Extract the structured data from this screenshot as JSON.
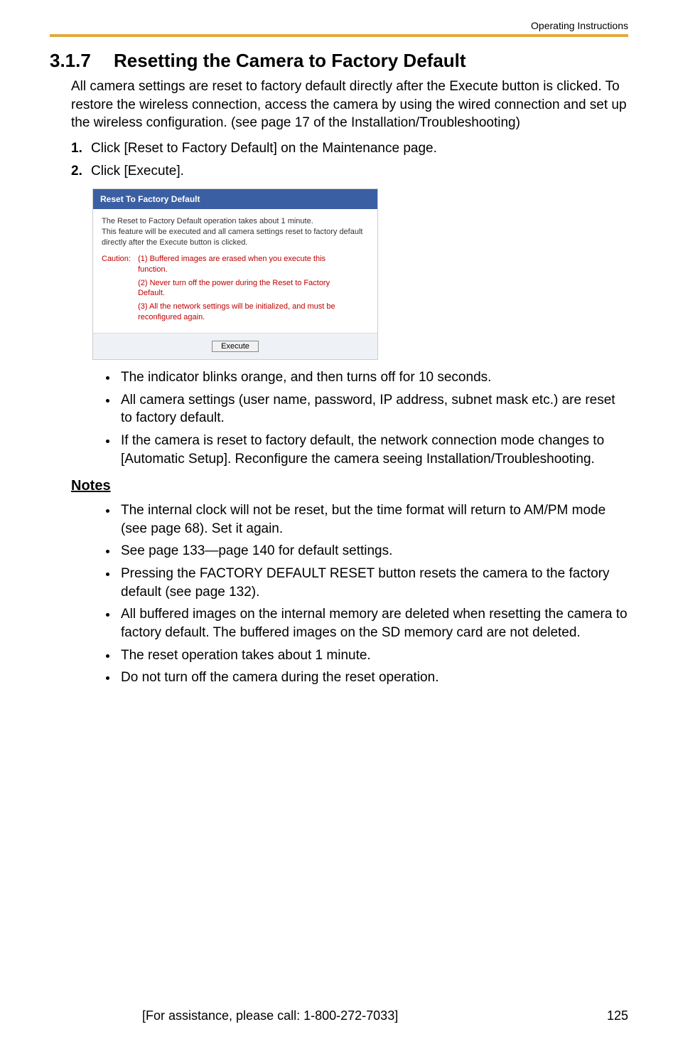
{
  "header": {
    "running": "Operating Instructions"
  },
  "section": {
    "number": "3.1.7",
    "title": "Resetting the Camera to Factory Default"
  },
  "intro": "All camera settings are reset to factory default directly after the Execute button is clicked. To restore the wireless connection, access the camera by using the wired connection and set up the wireless configuration. (see page 17 of the Installation/Troubleshooting)",
  "steps": [
    {
      "n": "1.",
      "text": "Click [Reset to Factory Default] on the Maintenance page."
    },
    {
      "n": "2.",
      "text": "Click [Execute]."
    }
  ],
  "dialog": {
    "title": "Reset To Factory Default",
    "para": "The Reset to Factory Default operation takes about 1 minute.\nThis feature will be executed and all camera settings reset to factory default directly after the Execute button is clicked.",
    "caution_label": "Caution:",
    "caution_items": [
      "(1) Buffered images are erased when you execute this function.",
      "(2) Never turn off the power during the Reset to Factory Default.",
      "(3) All the network settings will be initialized, and must be reconfigured again."
    ],
    "execute": "Execute"
  },
  "post_bullets": [
    "The indicator blinks orange, and then turns off for 10 seconds.",
    "All camera settings (user name, password, IP address, subnet mask etc.) are reset to factory default.",
    "If the camera is reset to factory default, the network connection mode changes to [Automatic Setup]. Reconfigure the camera seeing Installation/Troubleshooting."
  ],
  "notes_head": "Notes",
  "notes": [
    "The internal clock will not be reset, but the time format will return to AM/PM mode (see page 68). Set it again.",
    "See page 133—page 140 for default settings.",
    "Pressing the FACTORY DEFAULT RESET button resets the camera to the factory default (see page 132).",
    "All buffered images on the internal memory are deleted when resetting the camera to factory default. The buffered images on the SD memory card are not deleted.",
    "The reset operation takes about 1 minute.",
    "Do not turn off the camera during the reset operation."
  ],
  "footer": {
    "assist": "[For assistance, please call: 1-800-272-7033]",
    "page": "125"
  }
}
